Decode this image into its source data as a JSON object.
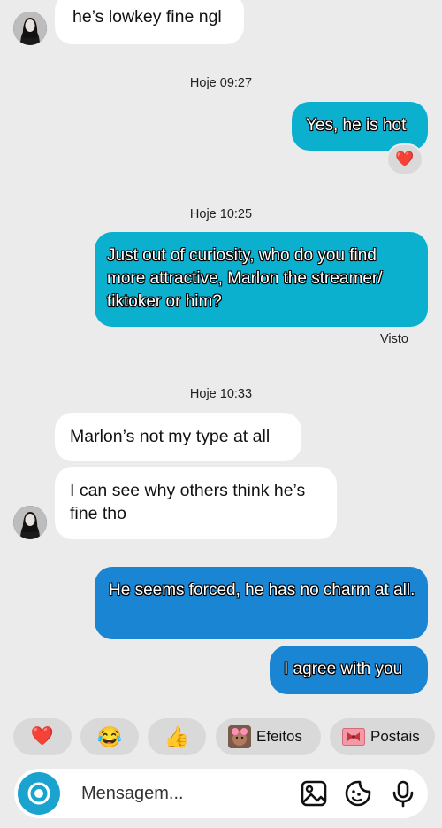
{
  "messages": {
    "m1": "he’s lowkey fine ngl",
    "ts1": "Hoje 09:27",
    "m2": "Yes, he is hot",
    "m2_reaction": "❤️",
    "ts2": "Hoje 10:25",
    "m3": "Just out of curiosity, who do you find more attractive, Marlon the streamer/ tiktoker or him?",
    "seen": "Visto",
    "ts3": "Hoje 10:33",
    "m4": "Marlon’s not my type at all",
    "m5": "I can see why others think he’s fine tho",
    "m6": "He seems forced, he has no charm at all.",
    "m7": "I agree with you"
  },
  "quick_reactions": {
    "heart": "❤️",
    "laugh": "😂",
    "thumbs": "👍",
    "effects_label": "Efeitos",
    "postcards_label": "Postais"
  },
  "composer": {
    "placeholder": "Mensagem..."
  },
  "colors": {
    "background": "#ebebeb",
    "incoming": "#ffffff",
    "outgoing_cyan": "#0bb0cf",
    "outgoing_blue": "#1a86d3",
    "camera_button": "#1aa3cf",
    "chip": "#d9d9d9"
  },
  "icons": [
    "camera-icon",
    "gallery-icon",
    "sticker-icon",
    "microphone-icon",
    "heart-reaction-icon"
  ]
}
